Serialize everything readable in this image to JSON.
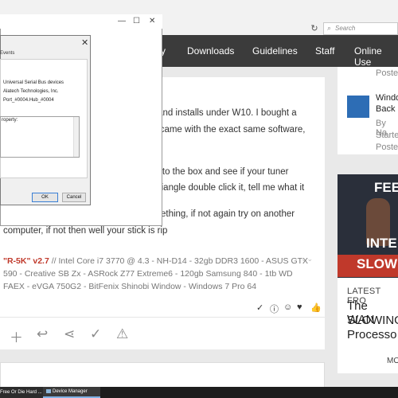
{
  "browser": {
    "search_placeholder": "Search",
    "reload_icon": "reload-icon",
    "search_icon": "search-icon"
  },
  "nav": {
    "items": [
      "y",
      "Downloads",
      "Guidelines",
      "Staff",
      "Online Use"
    ]
  },
  "post": {
    "lines": [
      "ts and installs under W10. I bought a",
      "l it came with the exact same software,",
      "c into the box and see if your tuner",
      "g triangle double click it, tell me what it",
      "omething, if not again try on another",
      "computer, if not then well your stick is rip"
    ],
    "signature_name": "\"R-5K\" v2.7",
    "signature_text": " // Intel Core i7 3770 @ 4.3 - NH-D14 -  32gb DDR3 1600 - ASUS GTX 590 - Creative SB Zx - ASRock Z77 Extreme6 - 120gb Samsung 840 - 1tb WD FAEX - eVGA 750G2 - BitFenix Shinobi Window - Windows 7 Pro 64",
    "reactions": [
      "check-icon",
      "info-icon",
      "smile-icon",
      "heart-icon",
      "thumbs-up-icon"
    ],
    "actions": [
      "plus-icon",
      "reply-icon",
      "share-icon",
      "check-icon",
      "warning-icon"
    ]
  },
  "sidebar": {
    "posted_1": "Posted",
    "item_title_1": "Windo",
    "item_title_2": "Back",
    "by": "By Na",
    "started": "Starte",
    "posted_2": "Posted",
    "ad_line_1": "FEE",
    "ad_line_2": "INTE",
    "ad_line_3": "SLOWI",
    "latest_label": "LATEST FRO",
    "latest_lines": [
      "The WAN",
      "SLOWING",
      "Processo"
    ],
    "more": "MO"
  },
  "dialog": {
    "tab_events": "Events",
    "device_type": "Universal Serial Bus devices",
    "manufacturer": "Alatech Technologies, Inc.",
    "location": "Port_#0004.Hub_#0004",
    "property_label": "roperty:",
    "ok": "OK",
    "cancel": "Cancel"
  },
  "taskbar": {
    "item_1": "Free Or Die Hard ...",
    "item_2": "Device Manager"
  }
}
